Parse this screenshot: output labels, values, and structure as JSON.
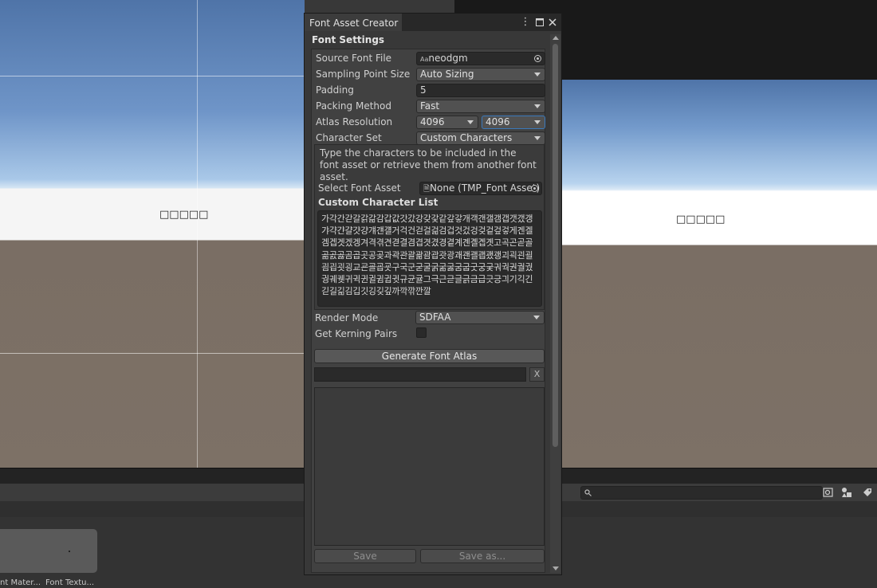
{
  "window": {
    "tab_title": "Font Asset Creator",
    "section_title": "Font Settings",
    "controls": {
      "menu": "⋮",
      "maximize": "▢",
      "close": "✕"
    }
  },
  "fields": {
    "source_font_label": "Source Font File",
    "source_font_value": "neodgm",
    "source_font_icon": "Aa",
    "sampling_label": "Sampling Point Size",
    "sampling_value": "Auto Sizing",
    "padding_label": "Padding",
    "padding_value": "5",
    "packing_label": "Packing Method",
    "packing_value": "Fast",
    "atlas_label": "Atlas Resolution",
    "atlas_width": "4096",
    "atlas_height": "4096",
    "charset_label": "Character Set",
    "charset_value": "Custom Characters",
    "help_text": "Type the characters to be included in the font asset or retrieve them from another font asset.",
    "select_font_asset_label": "Select Font Asset",
    "select_font_asset_value": "None (TMP_Font Asset)",
    "custom_list_label": "Custom Character List",
    "custom_chars": "가각간갇갈갉갊감갑값갓갔강갖갗같갚갛개객갠갤갬갭갯갰갱갸갹갼걀걋걍걔걘걜거걱건걷걸걺검겁것겄겅겆겉겊겋게겐겔겜겝겟겠겡겨격겪견겯결겸겹겻겼경곁계곈곌곕곗고곡곤곧골곪곬곯곰곱곳공곶과곽관괄괆괌괍괏광괘괜괠괩괬괭괴괵괸괼굄굅굇굉교굔굘굡굣구국군굳굴굵굶굻굼굽굿궁궂궈궉권궐궜궝궤궷귀귁귄귈귐귑귓규균귤그극근귿글긁금급긋긍긔기긱긴긷길긺김깁깃깅깆깊까깍깎깐깔",
    "render_mode_label": "Render Mode",
    "render_mode_value": "SDFAA",
    "kerning_label": "Get Kerning Pairs",
    "kerning_checked": false,
    "generate_button": "Generate Font Atlas",
    "progress": 0,
    "clear_button": "X",
    "save_button": "Save",
    "save_as_button": "Save as..."
  },
  "scene": {
    "missing_glyphs_left": "□□□□□",
    "missing_glyphs_right": "□□□□□"
  },
  "assets": {
    "items": [
      {
        "label": "nt Mater..."
      },
      {
        "label": "Font Textu..."
      }
    ]
  },
  "colors": {
    "accent": "#3a79bb",
    "window_bg": "#383838",
    "field_bg": "#2a2a2a"
  }
}
